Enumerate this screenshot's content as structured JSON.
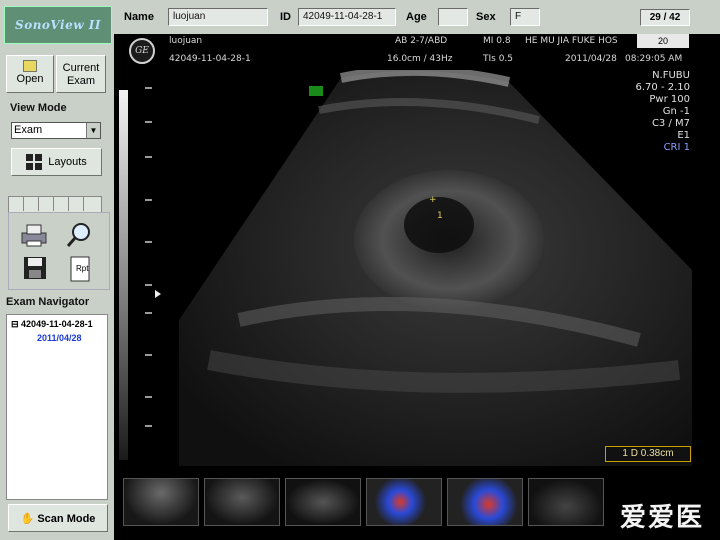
{
  "app": {
    "logo_text": "SonoView II"
  },
  "left_panel": {
    "open_label": "Open",
    "current_exam_label": "Current Exam",
    "view_mode_label": "View Mode",
    "view_mode_value": "Exam",
    "layouts_label": "Layouts",
    "report_icon_text": "Rpt",
    "exam_navigator_label": "Exam Navigator",
    "navigator_items": [
      {
        "study": "42049-11-04-28-1",
        "date": "2011/04/28"
      }
    ],
    "scan_mode_label": "Scan Mode"
  },
  "infobar": {
    "name_label": "Name",
    "name_value": "luojuan",
    "id_label": "ID",
    "id_value": "42049-11-04-28-1",
    "age_label": "Age",
    "age_value": "",
    "sex_label": "Sex",
    "sex_value": "F",
    "page_counter": "29 / 42"
  },
  "image_header": {
    "logo": "GE",
    "patient": "luojuan",
    "study_id": "42049-11-04-28-1",
    "probe": "AB 2-7/ABD",
    "depth_freq": "16.0cm / 43Hz",
    "mi": "MI  0.8",
    "tis": "TIs  0.5",
    "institution": "HE MU JIA FUKE HOS",
    "frame_number": "20",
    "date": "2011/04/28",
    "time": "08:29:05 AM"
  },
  "image_params": [
    "N.FUBU",
    "6.70 - 2.10",
    "Pwr 100",
    "Gn  -1",
    "C3 / M7",
    "E1",
    "CRI 1"
  ],
  "measurement": "1   D 0.38cm",
  "thumbnails_count": 6,
  "watermark": "爱爱医",
  "colors": {
    "panel": "#c8d0c8",
    "doppler_red": "#d83a2a",
    "doppler_blue": "#2a4ad8",
    "cri_blue": "#8aa0ff"
  }
}
